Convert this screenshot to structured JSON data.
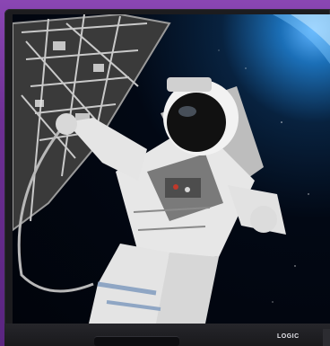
{
  "monitor": {
    "brand_label": "LOGIC"
  },
  "screen": {
    "image_subject": "astronaut-spacewalk-photo"
  },
  "colors": {
    "frame_purple": "#7b3fa0",
    "bezel_dark": "#1c1c1f",
    "space_black": "#01040b",
    "earth_glow": "#5fb4ff"
  }
}
